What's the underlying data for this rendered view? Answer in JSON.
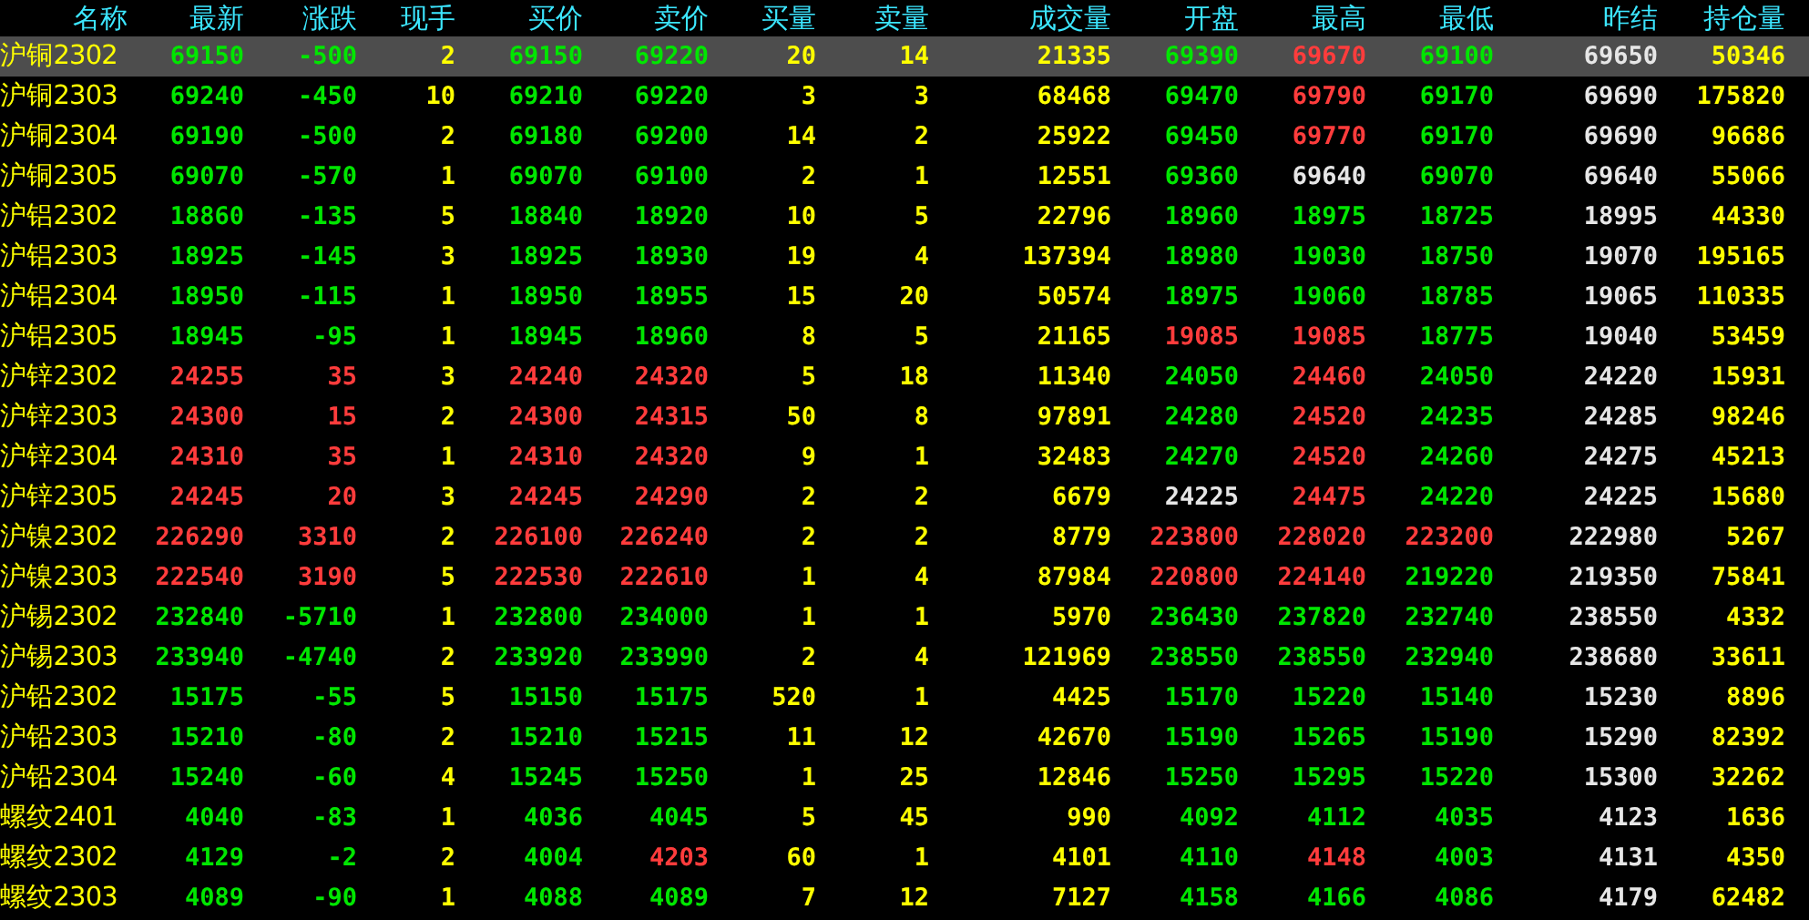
{
  "columns": [
    {
      "label": "名称",
      "kind": "name"
    },
    {
      "label": "最新",
      "kind": "price"
    },
    {
      "label": "涨跌",
      "kind": "price"
    },
    {
      "label": "现手",
      "kind": "volume"
    },
    {
      "label": "买价",
      "kind": "price"
    },
    {
      "label": "卖价",
      "kind": "price"
    },
    {
      "label": "买量",
      "kind": "volume"
    },
    {
      "label": "卖量",
      "kind": "volume"
    },
    {
      "label": "成交量",
      "kind": "volume"
    },
    {
      "label": "开盘",
      "kind": "price"
    },
    {
      "label": "最高",
      "kind": "price"
    },
    {
      "label": "最低",
      "kind": "price"
    },
    {
      "label": "昨结",
      "kind": "settle"
    },
    {
      "label": "持仓量",
      "kind": "volume"
    }
  ],
  "rows": [
    {
      "selected": true,
      "cells": [
        "沪铜2302",
        {
          "text": "69150",
          "color": "#00e600"
        },
        {
          "text": "-500",
          "color": "#00e600"
        },
        "2",
        {
          "text": "69150",
          "color": "#00e600"
        },
        {
          "text": "69220",
          "color": "#00e600"
        },
        "20",
        "14",
        "21335",
        {
          "text": "69390",
          "color": "#00e600"
        },
        {
          "text": "69670",
          "color": "#ff3c3c"
        },
        {
          "text": "69100",
          "color": "#00e600"
        },
        "69650",
        "50346"
      ]
    },
    {
      "selected": false,
      "cells": [
        "沪铜2303",
        {
          "text": "69240",
          "color": "#00e600"
        },
        {
          "text": "-450",
          "color": "#00e600"
        },
        "10",
        {
          "text": "69210",
          "color": "#00e600"
        },
        {
          "text": "69220",
          "color": "#00e600"
        },
        "3",
        "3",
        "68468",
        {
          "text": "69470",
          "color": "#00e600"
        },
        {
          "text": "69790",
          "color": "#ff3c3c"
        },
        {
          "text": "69170",
          "color": "#00e600"
        },
        "69690",
        "175820"
      ]
    },
    {
      "selected": false,
      "cells": [
        "沪铜2304",
        {
          "text": "69190",
          "color": "#00e600"
        },
        {
          "text": "-500",
          "color": "#00e600"
        },
        "2",
        {
          "text": "69180",
          "color": "#00e600"
        },
        {
          "text": "69200",
          "color": "#00e600"
        },
        "14",
        "2",
        "25922",
        {
          "text": "69450",
          "color": "#00e600"
        },
        {
          "text": "69770",
          "color": "#ff3c3c"
        },
        {
          "text": "69170",
          "color": "#00e600"
        },
        "69690",
        "96686"
      ]
    },
    {
      "selected": false,
      "cells": [
        "沪铜2305",
        {
          "text": "69070",
          "color": "#00e600"
        },
        {
          "text": "-570",
          "color": "#00e600"
        },
        "1",
        {
          "text": "69070",
          "color": "#00e600"
        },
        {
          "text": "69100",
          "color": "#00e600"
        },
        "2",
        "1",
        "12551",
        {
          "text": "69360",
          "color": "#00e600"
        },
        {
          "text": "69640",
          "color": "#e6e6e6"
        },
        {
          "text": "69070",
          "color": "#00e600"
        },
        "69640",
        "55066"
      ]
    },
    {
      "selected": false,
      "cells": [
        "沪铝2302",
        {
          "text": "18860",
          "color": "#00e600"
        },
        {
          "text": "-135",
          "color": "#00e600"
        },
        "5",
        {
          "text": "18840",
          "color": "#00e600"
        },
        {
          "text": "18920",
          "color": "#00e600"
        },
        "10",
        "5",
        "22796",
        {
          "text": "18960",
          "color": "#00e600"
        },
        {
          "text": "18975",
          "color": "#00e600"
        },
        {
          "text": "18725",
          "color": "#00e600"
        },
        "18995",
        "44330"
      ]
    },
    {
      "selected": false,
      "cells": [
        "沪铝2303",
        {
          "text": "18925",
          "color": "#00e600"
        },
        {
          "text": "-145",
          "color": "#00e600"
        },
        "3",
        {
          "text": "18925",
          "color": "#00e600"
        },
        {
          "text": "18930",
          "color": "#00e600"
        },
        "19",
        "4",
        "137394",
        {
          "text": "18980",
          "color": "#00e600"
        },
        {
          "text": "19030",
          "color": "#00e600"
        },
        {
          "text": "18750",
          "color": "#00e600"
        },
        "19070",
        "195165"
      ]
    },
    {
      "selected": false,
      "cells": [
        "沪铝2304",
        {
          "text": "18950",
          "color": "#00e600"
        },
        {
          "text": "-115",
          "color": "#00e600"
        },
        "1",
        {
          "text": "18950",
          "color": "#00e600"
        },
        {
          "text": "18955",
          "color": "#00e600"
        },
        "15",
        "20",
        "50574",
        {
          "text": "18975",
          "color": "#00e600"
        },
        {
          "text": "19060",
          "color": "#00e600"
        },
        {
          "text": "18785",
          "color": "#00e600"
        },
        "19065",
        "110335"
      ]
    },
    {
      "selected": false,
      "cells": [
        "沪铝2305",
        {
          "text": "18945",
          "color": "#00e600"
        },
        {
          "text": "-95",
          "color": "#00e600"
        },
        "1",
        {
          "text": "18945",
          "color": "#00e600"
        },
        {
          "text": "18960",
          "color": "#00e600"
        },
        "8",
        "5",
        "21165",
        {
          "text": "19085",
          "color": "#ff3c3c"
        },
        {
          "text": "19085",
          "color": "#ff3c3c"
        },
        {
          "text": "18775",
          "color": "#00e600"
        },
        "19040",
        "53459"
      ]
    },
    {
      "selected": false,
      "cells": [
        "沪锌2302",
        {
          "text": "24255",
          "color": "#ff3c3c"
        },
        {
          "text": "35",
          "color": "#ff3c3c"
        },
        "3",
        {
          "text": "24240",
          "color": "#ff3c3c"
        },
        {
          "text": "24320",
          "color": "#ff3c3c"
        },
        "5",
        "18",
        "11340",
        {
          "text": "24050",
          "color": "#00e600"
        },
        {
          "text": "24460",
          "color": "#ff3c3c"
        },
        {
          "text": "24050",
          "color": "#00e600"
        },
        "24220",
        "15931"
      ]
    },
    {
      "selected": false,
      "cells": [
        "沪锌2303",
        {
          "text": "24300",
          "color": "#ff3c3c"
        },
        {
          "text": "15",
          "color": "#ff3c3c"
        },
        "2",
        {
          "text": "24300",
          "color": "#ff3c3c"
        },
        {
          "text": "24315",
          "color": "#ff3c3c"
        },
        "50",
        "8",
        "97891",
        {
          "text": "24280",
          "color": "#00e600"
        },
        {
          "text": "24520",
          "color": "#ff3c3c"
        },
        {
          "text": "24235",
          "color": "#00e600"
        },
        "24285",
        "98246"
      ]
    },
    {
      "selected": false,
      "cells": [
        "沪锌2304",
        {
          "text": "24310",
          "color": "#ff3c3c"
        },
        {
          "text": "35",
          "color": "#ff3c3c"
        },
        "1",
        {
          "text": "24310",
          "color": "#ff3c3c"
        },
        {
          "text": "24320",
          "color": "#ff3c3c"
        },
        "9",
        "1",
        "32483",
        {
          "text": "24270",
          "color": "#00e600"
        },
        {
          "text": "24520",
          "color": "#ff3c3c"
        },
        {
          "text": "24260",
          "color": "#00e600"
        },
        "24275",
        "45213"
      ]
    },
    {
      "selected": false,
      "cells": [
        "沪锌2305",
        {
          "text": "24245",
          "color": "#ff3c3c"
        },
        {
          "text": "20",
          "color": "#ff3c3c"
        },
        "3",
        {
          "text": "24245",
          "color": "#ff3c3c"
        },
        {
          "text": "24290",
          "color": "#ff3c3c"
        },
        "2",
        "2",
        "6679",
        {
          "text": "24225",
          "color": "#e6e6e6"
        },
        {
          "text": "24475",
          "color": "#ff3c3c"
        },
        {
          "text": "24220",
          "color": "#00e600"
        },
        "24225",
        "15680"
      ]
    },
    {
      "selected": false,
      "cells": [
        "沪镍2302",
        {
          "text": "226290",
          "color": "#ff3c3c"
        },
        {
          "text": "3310",
          "color": "#ff3c3c"
        },
        "2",
        {
          "text": "226100",
          "color": "#ff3c3c"
        },
        {
          "text": "226240",
          "color": "#ff3c3c"
        },
        "2",
        "2",
        "8779",
        {
          "text": "223800",
          "color": "#ff3c3c"
        },
        {
          "text": "228020",
          "color": "#ff3c3c"
        },
        {
          "text": "223200",
          "color": "#ff3c3c"
        },
        "222980",
        "5267"
      ]
    },
    {
      "selected": false,
      "cells": [
        "沪镍2303",
        {
          "text": "222540",
          "color": "#ff3c3c"
        },
        {
          "text": "3190",
          "color": "#ff3c3c"
        },
        "5",
        {
          "text": "222530",
          "color": "#ff3c3c"
        },
        {
          "text": "222610",
          "color": "#ff3c3c"
        },
        "1",
        "4",
        "87984",
        {
          "text": "220800",
          "color": "#ff3c3c"
        },
        {
          "text": "224140",
          "color": "#ff3c3c"
        },
        {
          "text": "219220",
          "color": "#00e600"
        },
        "219350",
        "75841"
      ]
    },
    {
      "selected": false,
      "cells": [
        "沪锡2302",
        {
          "text": "232840",
          "color": "#00e600"
        },
        {
          "text": "-5710",
          "color": "#00e600"
        },
        "1",
        {
          "text": "232800",
          "color": "#00e600"
        },
        {
          "text": "234000",
          "color": "#00e600"
        },
        "1",
        "1",
        "5970",
        {
          "text": "236430",
          "color": "#00e600"
        },
        {
          "text": "237820",
          "color": "#00e600"
        },
        {
          "text": "232740",
          "color": "#00e600"
        },
        "238550",
        "4332"
      ]
    },
    {
      "selected": false,
      "cells": [
        "沪锡2303",
        {
          "text": "233940",
          "color": "#00e600"
        },
        {
          "text": "-4740",
          "color": "#00e600"
        },
        "2",
        {
          "text": "233920",
          "color": "#00e600"
        },
        {
          "text": "233990",
          "color": "#00e600"
        },
        "2",
        "4",
        "121969",
        {
          "text": "238550",
          "color": "#00e600"
        },
        {
          "text": "238550",
          "color": "#00e600"
        },
        {
          "text": "232940",
          "color": "#00e600"
        },
        "238680",
        "33611"
      ]
    },
    {
      "selected": false,
      "cells": [
        "沪铅2302",
        {
          "text": "15175",
          "color": "#00e600"
        },
        {
          "text": "-55",
          "color": "#00e600"
        },
        "5",
        {
          "text": "15150",
          "color": "#00e600"
        },
        {
          "text": "15175",
          "color": "#00e600"
        },
        "520",
        "1",
        "4425",
        {
          "text": "15170",
          "color": "#00e600"
        },
        {
          "text": "15220",
          "color": "#00e600"
        },
        {
          "text": "15140",
          "color": "#00e600"
        },
        "15230",
        "8896"
      ]
    },
    {
      "selected": false,
      "cells": [
        "沪铅2303",
        {
          "text": "15210",
          "color": "#00e600"
        },
        {
          "text": "-80",
          "color": "#00e600"
        },
        "2",
        {
          "text": "15210",
          "color": "#00e600"
        },
        {
          "text": "15215",
          "color": "#00e600"
        },
        "11",
        "12",
        "42670",
        {
          "text": "15190",
          "color": "#00e600"
        },
        {
          "text": "15265",
          "color": "#00e600"
        },
        {
          "text": "15190",
          "color": "#00e600"
        },
        "15290",
        "82392"
      ]
    },
    {
      "selected": false,
      "cells": [
        "沪铅2304",
        {
          "text": "15240",
          "color": "#00e600"
        },
        {
          "text": "-60",
          "color": "#00e600"
        },
        "4",
        {
          "text": "15245",
          "color": "#00e600"
        },
        {
          "text": "15250",
          "color": "#00e600"
        },
        "1",
        "25",
        "12846",
        {
          "text": "15250",
          "color": "#00e600"
        },
        {
          "text": "15295",
          "color": "#00e600"
        },
        {
          "text": "15220",
          "color": "#00e600"
        },
        "15300",
        "32262"
      ]
    },
    {
      "selected": false,
      "cells": [
        "螺纹2401",
        {
          "text": "4040",
          "color": "#00e600"
        },
        {
          "text": "-83",
          "color": "#00e600"
        },
        "1",
        {
          "text": "4036",
          "color": "#00e600"
        },
        {
          "text": "4045",
          "color": "#00e600"
        },
        "5",
        "45",
        "990",
        {
          "text": "4092",
          "color": "#00e600"
        },
        {
          "text": "4112",
          "color": "#00e600"
        },
        {
          "text": "4035",
          "color": "#00e600"
        },
        "4123",
        "1636"
      ]
    },
    {
      "selected": false,
      "cells": [
        "螺纹2302",
        {
          "text": "4129",
          "color": "#00e600"
        },
        {
          "text": "-2",
          "color": "#00e600"
        },
        "2",
        {
          "text": "4004",
          "color": "#00e600"
        },
        {
          "text": "4203",
          "color": "#ff3c3c"
        },
        "60",
        "1",
        "4101",
        {
          "text": "4110",
          "color": "#00e600"
        },
        {
          "text": "4148",
          "color": "#ff3c3c"
        },
        {
          "text": "4003",
          "color": "#00e600"
        },
        "4131",
        "4350"
      ]
    },
    {
      "selected": false,
      "cells": [
        "螺纹2303",
        {
          "text": "4089",
          "color": "#00e600"
        },
        {
          "text": "-90",
          "color": "#00e600"
        },
        "1",
        {
          "text": "4088",
          "color": "#00e600"
        },
        {
          "text": "4089",
          "color": "#00e600"
        },
        "7",
        "12",
        "7127",
        {
          "text": "4158",
          "color": "#00e600"
        },
        {
          "text": "4166",
          "color": "#00e600"
        },
        {
          "text": "4086",
          "color": "#00e600"
        },
        "4179",
        "62482"
      ]
    }
  ]
}
